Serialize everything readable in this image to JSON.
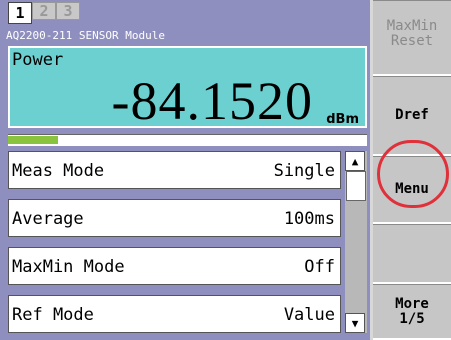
{
  "tabs": [
    "1",
    "2",
    "3"
  ],
  "module_title": "AQ2200-211 SENSOR Module",
  "power": {
    "label": "Power",
    "value": "-84.1520",
    "unit": "dBm"
  },
  "level_bar": {
    "fraction": 0.14,
    "color": "#8ac43f"
  },
  "settings": [
    {
      "label": "Meas Mode",
      "value": "Single"
    },
    {
      "label": "Average",
      "value": "100ms"
    },
    {
      "label": "MaxMin Mode",
      "value": "Off"
    },
    {
      "label": "Ref Mode",
      "value": "Value"
    }
  ],
  "scroll": {
    "up_icon": "▲",
    "down_icon": "▼"
  },
  "softkeys": {
    "maxmin_reset": "MaxMin\nReset",
    "dref": "Dref",
    "menu": "Menu",
    "empty": "",
    "more": "More\n1/5"
  },
  "colors": {
    "panel_bg": "#8f8fbf",
    "display_bg": "#6dd0d0",
    "highlight": "#e0303a"
  }
}
